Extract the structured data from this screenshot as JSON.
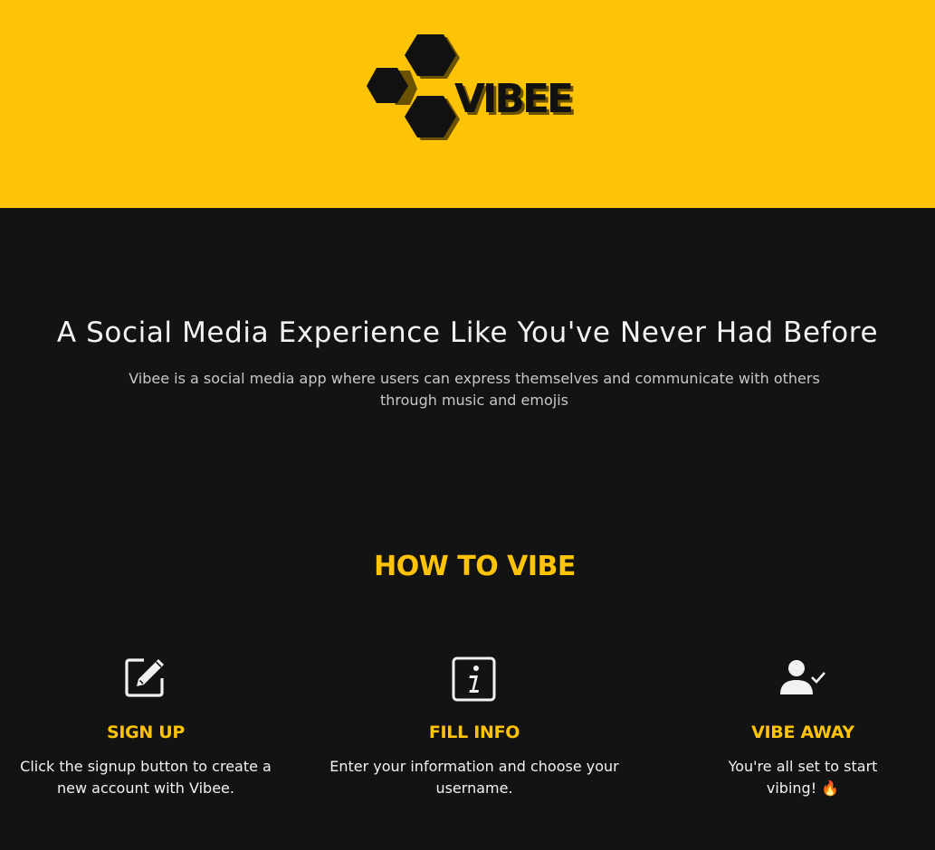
{
  "header": {
    "logo_text": "VIBEE",
    "background_color": "#fdc307"
  },
  "hero": {
    "title": "A Social Media Experience Like You've Never Had Before",
    "subtitle": "Vibee is a social media app where users can express themselves and communicate with others through music and emojis"
  },
  "how_to": {
    "title": "HOW TO VIBE",
    "steps": [
      {
        "icon": "edit-icon",
        "title": "SIGN UP",
        "text": "Click the signup button to create a new account with Vibee."
      },
      {
        "icon": "info-icon",
        "title": "FILL INFO",
        "text": "Enter your information and choose your username."
      },
      {
        "icon": "user-check-icon",
        "title": "VIBE AWAY",
        "text": "You're all set to start vibing! 🔥"
      }
    ]
  },
  "colors": {
    "accent": "#fdc307",
    "background": "#131313",
    "text": "#f2f2f2"
  }
}
